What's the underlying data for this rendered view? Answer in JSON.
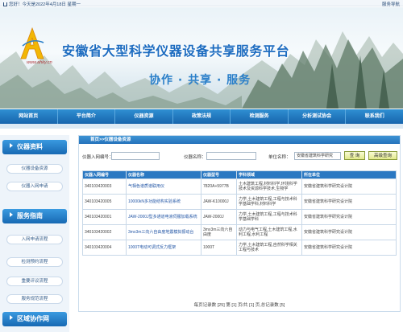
{
  "topbar": {
    "date_text": "您好！今天是2022年4月18日 星期一",
    "site_nav": "服务导航"
  },
  "banner": {
    "logo_url": "www.ahky.cn",
    "title": "安徽省大型科学仪器设备共享服务平台",
    "slogan": "协作 · 共享 · 服务"
  },
  "nav": [
    "网站首页",
    "平台简介",
    "仪器资源",
    "政策法规",
    "检测服务",
    "分析测试协会",
    "联系我们"
  ],
  "sidebar": {
    "sections": [
      {
        "title": "仪器资料",
        "items": [
          "仪器设备资源",
          "仪器入网申请"
        ]
      },
      {
        "title": "服务指南",
        "items": [
          "入网申请流程",
          "检测预约流程",
          "重要评议流程",
          "服务规范流程"
        ]
      },
      {
        "title": "区域协作网",
        "items": []
      }
    ]
  },
  "main": {
    "breadcrumb": "首页>>仪器设备资源",
    "search": {
      "code_label": "仪器入网编号：",
      "code_value": "",
      "name_label": "仪器名称：",
      "name_value": "",
      "unit_label": "单位名称：",
      "unit_value": "安徽省建筑科学研究",
      "query_button": "查 询",
      "advanced_button": "高级查询"
    },
    "table": {
      "headers": [
        "仪器入网编号",
        "仪器名称",
        "仪器型号",
        "学科领域",
        "所在单位"
      ],
      "rows": [
        [
          "340103420003",
          "气相色谱质谱联用仪",
          "7820A+5977B",
          "土木建筑工程,材料科学,环境科学技术及资源科学技术,生物学",
          "安徽省建筑科学研究设计院"
        ],
        [
          "340103420005",
          "10000kN多功能结构实验系统",
          "JAW-K10000J",
          "力学,土木建筑工程,工程与技术科学基础学科,材料科学",
          "安徽省建筑科学研究设计院"
        ],
        [
          "340103420001",
          "JAW-2000J型多通道电液伺服加载系统",
          "JAW-2000J",
          "力学,土木建筑工程,工程与技术科学基础学科",
          "安徽省建筑科学研究设计院"
        ],
        [
          "340103420002",
          "3mx3m三向六自由度地震模拟振动台",
          "3mx3m三向六自由度",
          "动力与电气工程,土木建筑工程,水利工程,水利工程",
          "安徽省建筑科学研究设计院"
        ],
        [
          "340103420004",
          "1000T电动可调式反力框架",
          "1000T",
          "力学,土木建筑工程,自然科学相关工程与技术",
          "安徽省建筑科学研究设计院"
        ]
      ]
    },
    "pager": "每页记录数 [25] 第 [1] 页/共 [1] 页,总记录数 [5]"
  }
}
